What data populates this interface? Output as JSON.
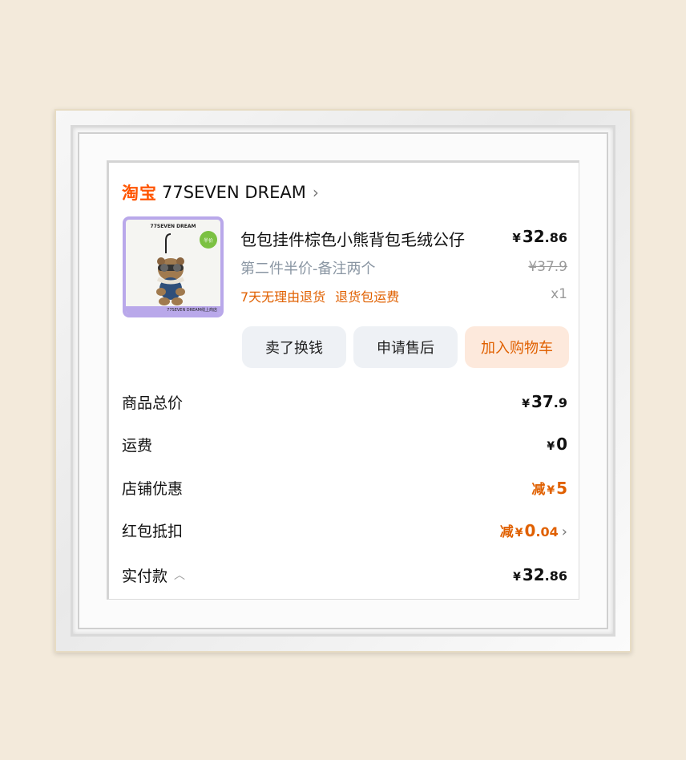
{
  "shop": {
    "platform_label": "淘宝",
    "name": "77SEVEN DREAM"
  },
  "product": {
    "title": "包包挂件棕色小熊背包毛绒公仔",
    "price_currency": "¥",
    "price_int": "32",
    "price_dec": ".86",
    "subtitle": "第二件半价-备注两个",
    "original_price": "¥37.9",
    "tags": [
      "7天无理由退货",
      "退货包运费"
    ],
    "quantity": "x1",
    "image": {
      "brand_text": "77SEVEN DREAM",
      "badge_text": "半价",
      "footer_text": "77SEVEN DREAM线上商店"
    }
  },
  "actions": {
    "sell": "卖了换钱",
    "after_sale": "申请售后",
    "add_cart": "加入购物车"
  },
  "summary": {
    "goods_total_label": "商品总价",
    "goods_total_cur": "¥",
    "goods_total_int": "37",
    "goods_total_dec": ".9",
    "shipping_label": "运费",
    "shipping_cur": "¥",
    "shipping_val": "0",
    "store_discount_label": "店铺优惠",
    "store_discount_prefix": "减",
    "store_discount_cur": "¥",
    "store_discount_val": "5",
    "redpacket_label": "红包抵扣",
    "redpacket_prefix": "减",
    "redpacket_cur": "¥",
    "redpacket_int": "0",
    "redpacket_dec": ".04",
    "paid_label": "实付款",
    "paid_cur": "¥",
    "paid_int": "32",
    "paid_dec": ".86"
  },
  "colors": {
    "accent": "#ff5500",
    "orange_text": "#e06000",
    "button_bg": "#eef1f5",
    "cart_bg": "#fde9dc"
  }
}
